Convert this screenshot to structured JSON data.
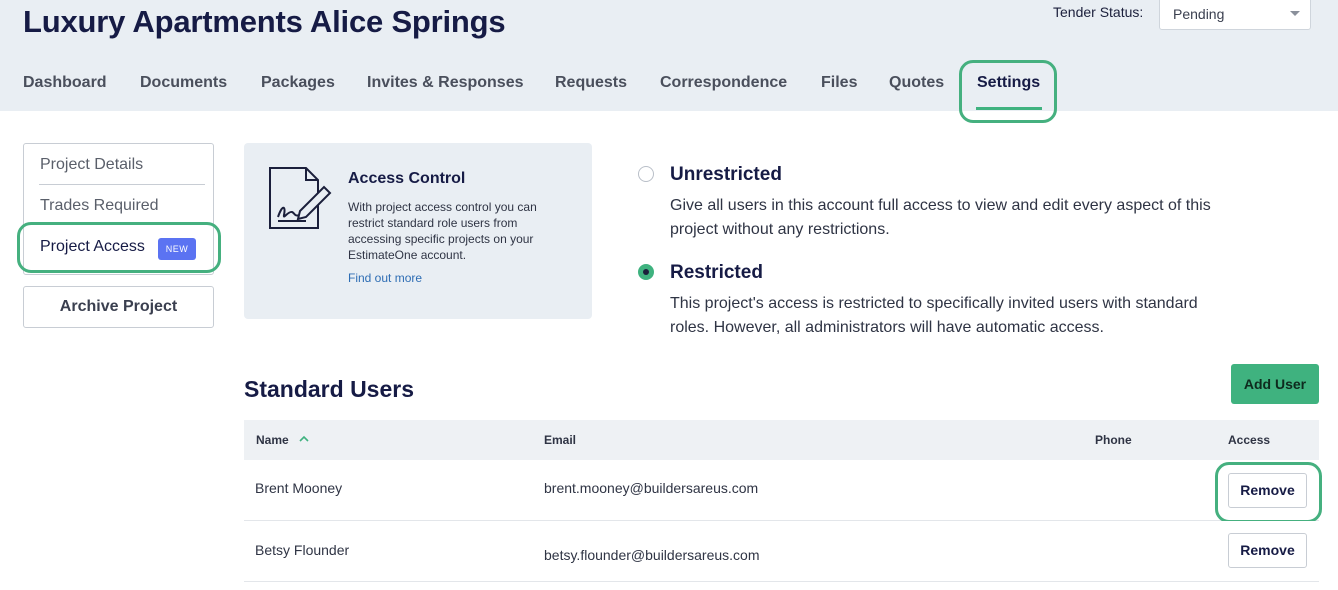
{
  "header": {
    "project_title": "Luxury Apartments Alice Springs",
    "tender_status_label": "Tender Status:",
    "tender_status_value": "Pending"
  },
  "tabs": [
    {
      "label": "Dashboard",
      "active": false
    },
    {
      "label": "Documents",
      "active": false
    },
    {
      "label": "Packages",
      "active": false
    },
    {
      "label": "Invites & Responses",
      "active": false
    },
    {
      "label": "Requests",
      "active": false
    },
    {
      "label": "Correspondence",
      "active": false
    },
    {
      "label": "Files",
      "active": false
    },
    {
      "label": "Quotes",
      "active": false
    },
    {
      "label": "Settings",
      "active": true
    }
  ],
  "sidebar": {
    "items": [
      {
        "label": "Project Details",
        "active": false
      },
      {
        "label": "Trades Required",
        "active": false
      },
      {
        "label": "Project Access",
        "active": true,
        "badge": "NEW"
      }
    ],
    "archive_label": "Archive Project"
  },
  "access_control": {
    "title": "Access Control",
    "body": "With project access control you can restrict standard role users from accessing specific projects on your EstimateOne account.",
    "link": "Find out more",
    "icon": "document-signature-icon"
  },
  "options": [
    {
      "title": "Unrestricted",
      "description": "Give all users in this account full access to view and edit every aspect of this project without any restrictions.",
      "selected": false
    },
    {
      "title": "Restricted",
      "description": "This project's access is restricted to specifically invited users with standard roles. However, all administrators will have automatic access.",
      "selected": true
    }
  ],
  "standard_users": {
    "title": "Standard Users",
    "add_user_label": "Add User",
    "columns": {
      "name": "Name",
      "email": "Email",
      "phone": "Phone",
      "access": "Access"
    },
    "sort": {
      "column": "name",
      "direction": "ascending"
    },
    "rows": [
      {
        "name": "Brent Mooney",
        "email": "brent.mooney@buildersareus.com",
        "phone": "",
        "action": "Remove"
      },
      {
        "name": "Betsy Flounder",
        "email": "betsy.flounder@buildersareus.com",
        "phone": "",
        "action": "Remove"
      }
    ]
  },
  "colors": {
    "accent_green": "#3fb27f",
    "highlight_green": "#45b07f",
    "badge_blue": "#5b73f2",
    "title_navy": "#161b45",
    "header_bg": "#e9eef3"
  }
}
